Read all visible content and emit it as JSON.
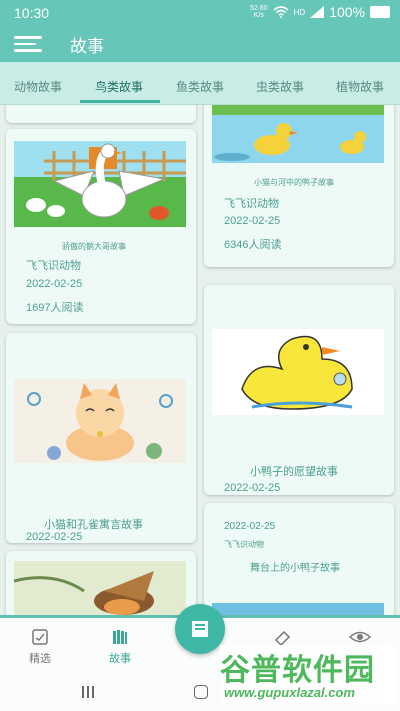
{
  "status_bar": {
    "time": "10:30",
    "net_speed_value": "52.60",
    "net_speed_unit": "K/s",
    "hd": "HD",
    "battery": "100%"
  },
  "app_bar": {
    "title": "故事"
  },
  "tabs": [
    {
      "label": "动物故事"
    },
    {
      "label": "鸟类故事"
    },
    {
      "label": "鱼类故事"
    },
    {
      "label": "虫类故事"
    },
    {
      "label": "植物故事"
    }
  ],
  "cards": {
    "goose": {
      "title": "骄傲的鹅大哥故事",
      "author": "飞飞识动物",
      "date": "2022-02-25",
      "reads": "1697人阅读"
    },
    "cat": {
      "title": "小猫和孔雀寓言故事",
      "date": "2022-02-25"
    },
    "duck_river": {
      "title": "小猫与河中的鸭子故事",
      "author": "飞飞识动物",
      "date": "2022-02-25",
      "reads": "6346人阅读"
    },
    "duck_wish": {
      "title": "小鸭子的愿望故事",
      "date": "2022-02-25"
    },
    "duck_stage": {
      "date": "2022-02-25",
      "author": "飞飞识动物",
      "title": "舞台上的小鸭子故事"
    }
  },
  "bottom_nav": [
    {
      "label": "精选",
      "icon": "featured-icon"
    },
    {
      "label": "故事",
      "icon": "books-icon"
    },
    {
      "label": "",
      "icon": "book-icon"
    },
    {
      "label": "",
      "icon": "eraser-icon"
    },
    {
      "label": "",
      "icon": "eye-icon"
    }
  ],
  "watermark": {
    "brand": "谷普软件园",
    "url": "www.gupuxlazal.com"
  },
  "colors": {
    "primary": "#66c6b8",
    "accent": "#3eb8a5",
    "tab_bg": "#c9ede6",
    "text_teal": "#4e9f92"
  }
}
